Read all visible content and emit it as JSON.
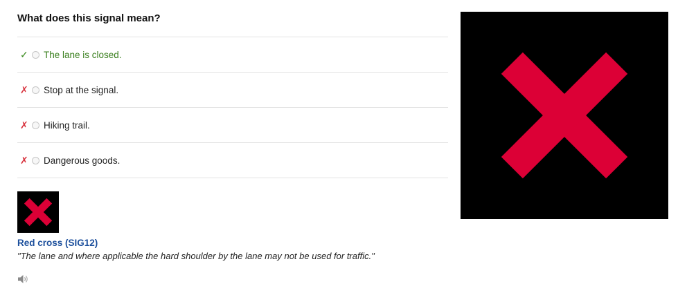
{
  "question": {
    "title": "What does this signal mean?"
  },
  "answers": [
    {
      "label": "The lane is closed.",
      "status": "correct",
      "mark": "✓"
    },
    {
      "label": "Stop at the signal.",
      "status": "wrong",
      "mark": "✗"
    },
    {
      "label": "Hiking trail.",
      "status": "wrong",
      "mark": "✗"
    },
    {
      "label": "Dangerous goods.",
      "status": "wrong",
      "mark": "✗"
    }
  ],
  "explanation": {
    "sign_name": "Red cross (SIG12)",
    "sign_description": "\"The lane and where applicable the hard shoulder by the lane may not be used for traffic.\"",
    "thumbnail_icon": "red-cross-signal-icon",
    "audio_icon": "speaker-icon"
  },
  "signal_image": {
    "icon": "red-cross-signal-icon"
  },
  "colors": {
    "correct": "#3a8a1e",
    "wrong": "#d8333e",
    "signal_cross": "#dc0036",
    "signal_background": "#000000",
    "link_blue": "#1c4f9c"
  }
}
